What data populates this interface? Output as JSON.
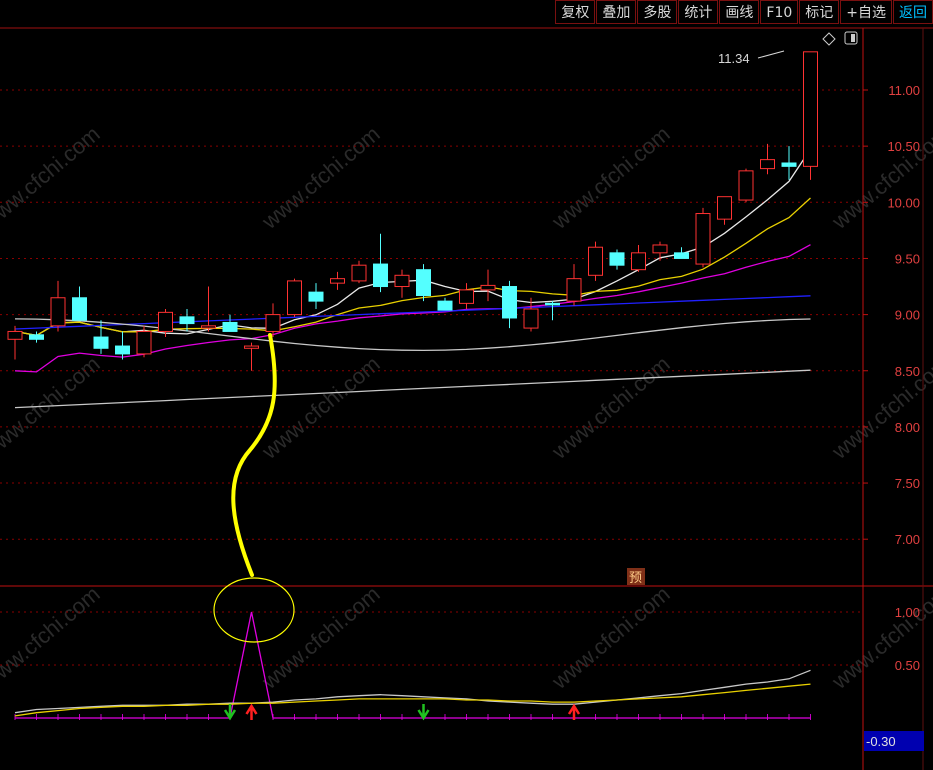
{
  "toolbar": {
    "buttons": [
      "复权",
      "叠加",
      "多股",
      "统计",
      "画线",
      "F10",
      "标记",
      "+自选",
      "返回"
    ]
  },
  "watermark": "www.cfchi.com",
  "price_flag": "预",
  "last_price_label": "11.34",
  "bottom_value_label": "-0.30",
  "colors": {
    "up": "#ff3232",
    "down": "#54ffff",
    "ma5": "#e8e8e8",
    "ma10": "#e8d000",
    "ma20": "#e000e0",
    "ma60": "#2020ff",
    "ma_long1": "#c8c8c8",
    "ma_long2": "#c8c8c8",
    "annotation": "#ffff00",
    "grid": "#8a0000"
  },
  "chart_data": [
    {
      "type": "candlestick",
      "y_ticks": [
        "11.00",
        "10.50",
        "10.00",
        "9.50",
        "9.00",
        "8.50",
        "8.00",
        "7.50",
        "7.00"
      ],
      "ylim": [
        6.6,
        11.9
      ],
      "candles": [
        [
          8.78,
          8.9,
          8.6,
          8.85
        ],
        [
          8.82,
          8.85,
          8.75,
          8.78
        ],
        [
          8.9,
          9.3,
          8.85,
          9.15
        ],
        [
          9.15,
          9.25,
          8.95,
          8.95
        ],
        [
          8.8,
          8.95,
          8.65,
          8.7
        ],
        [
          8.72,
          8.85,
          8.6,
          8.65
        ],
        [
          8.65,
          8.9,
          8.62,
          8.85
        ],
        [
          8.85,
          9.05,
          8.8,
          9.02
        ],
        [
          8.98,
          9.05,
          8.85,
          8.92
        ],
        [
          8.88,
          9.25,
          8.85,
          8.9
        ],
        [
          8.93,
          9.0,
          8.85,
          8.85
        ],
        [
          8.7,
          8.75,
          8.5,
          8.72
        ],
        [
          8.85,
          9.1,
          8.8,
          9.0
        ],
        [
          9.0,
          9.32,
          8.98,
          9.3
        ],
        [
          9.2,
          9.28,
          9.05,
          9.12
        ],
        [
          9.28,
          9.38,
          9.22,
          9.32
        ],
        [
          9.3,
          9.48,
          9.28,
          9.44
        ],
        [
          9.45,
          9.72,
          9.2,
          9.25
        ],
        [
          9.25,
          9.4,
          9.15,
          9.35
        ],
        [
          9.4,
          9.45,
          9.12,
          9.17
        ],
        [
          9.12,
          9.15,
          9.05,
          9.04
        ],
        [
          9.1,
          9.28,
          9.05,
          9.22
        ],
        [
          9.22,
          9.4,
          9.12,
          9.26
        ],
        [
          9.25,
          9.3,
          8.88,
          8.97
        ],
        [
          8.88,
          9.15,
          8.85,
          9.05
        ],
        [
          9.1,
          9.12,
          8.95,
          9.09
        ],
        [
          9.12,
          9.45,
          9.08,
          9.32
        ],
        [
          9.35,
          9.65,
          9.3,
          9.6
        ],
        [
          9.55,
          9.58,
          9.4,
          9.44
        ],
        [
          9.4,
          9.62,
          9.38,
          9.55
        ],
        [
          9.55,
          9.65,
          9.48,
          9.62
        ],
        [
          9.55,
          9.6,
          9.5,
          9.5
        ],
        [
          9.45,
          9.95,
          9.42,
          9.9
        ],
        [
          9.85,
          10.05,
          9.8,
          10.05
        ],
        [
          10.02,
          10.3,
          10.0,
          10.28
        ],
        [
          10.3,
          10.52,
          10.25,
          10.38
        ],
        [
          10.35,
          10.5,
          10.2,
          10.32
        ],
        [
          10.32,
          11.34,
          10.2,
          11.34
        ]
      ]
    },
    {
      "type": "line",
      "y_ticks": [
        "1.00",
        "0.50"
      ],
      "ylim": [
        -0.3,
        1.2
      ],
      "series": [
        {
          "values": [
            0,
            0,
            0,
            0,
            0,
            0,
            0,
            0,
            0,
            0,
            0,
            1.0,
            0,
            0,
            0,
            0,
            0,
            0,
            0,
            0,
            0,
            0,
            0,
            0,
            0,
            0,
            0,
            0,
            0,
            0,
            0,
            0,
            0,
            0,
            0,
            0,
            0,
            0
          ]
        },
        {
          "values": [
            0.05,
            0.08,
            0.09,
            0.1,
            0.11,
            0.12,
            0.12,
            0.12,
            0.13,
            0.13,
            0.14,
            0.14,
            0.15,
            0.17,
            0.18,
            0.2,
            0.21,
            0.22,
            0.21,
            0.2,
            0.19,
            0.18,
            0.16,
            0.15,
            0.14,
            0.13,
            0.13,
            0.15,
            0.17,
            0.19,
            0.21,
            0.23,
            0.26,
            0.29,
            0.32,
            0.34,
            0.37,
            0.45
          ]
        },
        {
          "values": [
            0.02,
            0.05,
            0.07,
            0.09,
            0.1,
            0.11,
            0.11,
            0.12,
            0.12,
            0.13,
            0.13,
            0.14,
            0.14,
            0.15,
            0.16,
            0.17,
            0.18,
            0.18,
            0.18,
            0.18,
            0.18,
            0.17,
            0.17,
            0.16,
            0.16,
            0.15,
            0.15,
            0.16,
            0.17,
            0.18,
            0.19,
            0.2,
            0.22,
            0.24,
            0.26,
            0.28,
            0.3,
            0.32
          ]
        }
      ],
      "signals": [
        {
          "index": 10,
          "type": "down-arrow",
          "color": "#20c020"
        },
        {
          "index": 11,
          "type": "up-arrow",
          "color": "#ff2020"
        },
        {
          "index": 19,
          "type": "down-arrow",
          "color": "#20c020"
        },
        {
          "index": 26,
          "type": "up-arrow",
          "color": "#ff2020"
        }
      ]
    }
  ]
}
